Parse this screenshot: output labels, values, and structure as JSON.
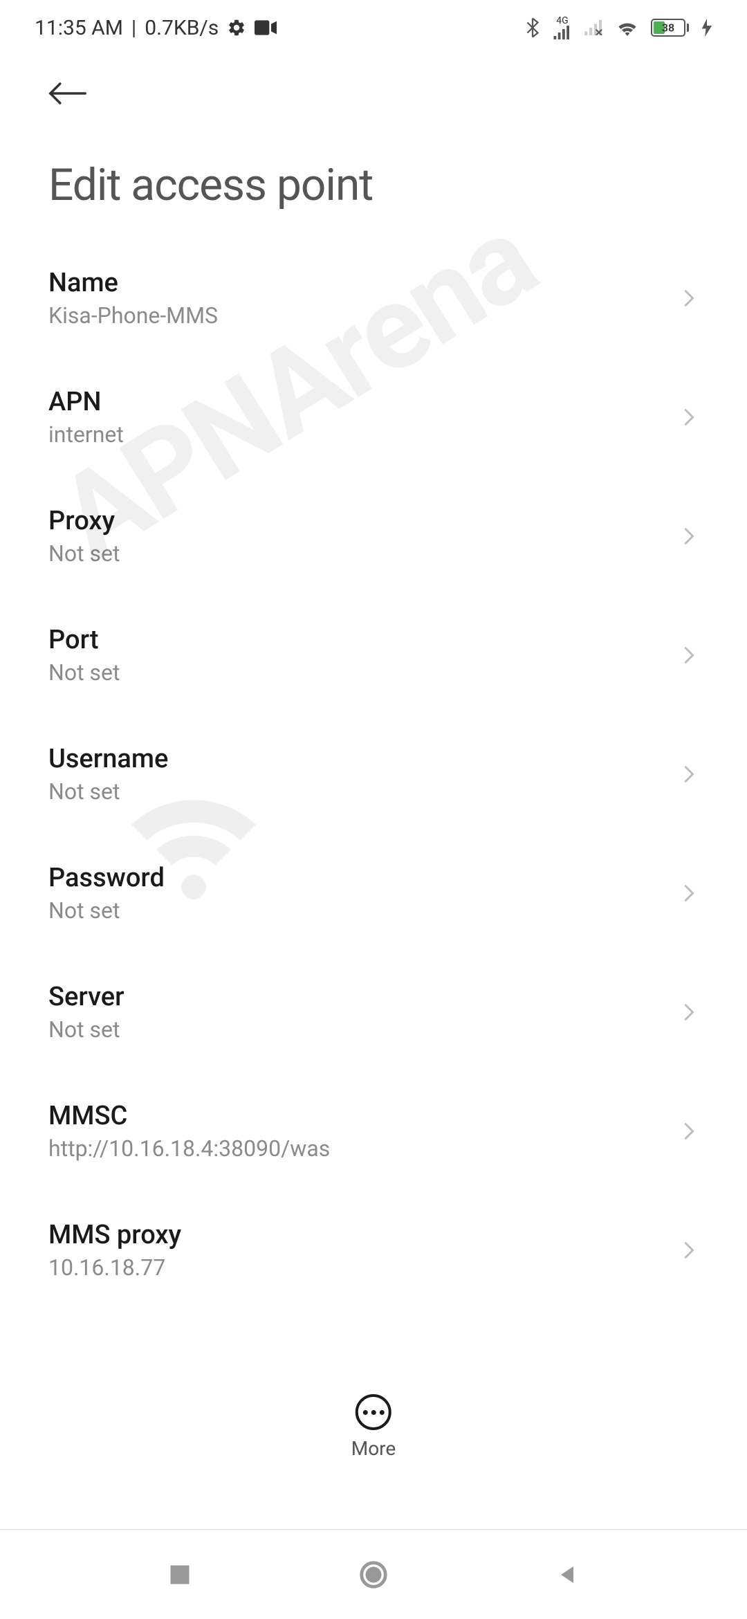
{
  "status_bar": {
    "time": "11:35 AM",
    "separator": "|",
    "speed": "0.7KB/s",
    "battery": "38",
    "network_label": "4G"
  },
  "header": {
    "title": "Edit access point"
  },
  "settings": [
    {
      "label": "Name",
      "value": "Kisa-Phone-MMS"
    },
    {
      "label": "APN",
      "value": "internet"
    },
    {
      "label": "Proxy",
      "value": "Not set"
    },
    {
      "label": "Port",
      "value": "Not set"
    },
    {
      "label": "Username",
      "value": "Not set"
    },
    {
      "label": "Password",
      "value": "Not set"
    },
    {
      "label": "Server",
      "value": "Not set"
    },
    {
      "label": "MMSC",
      "value": "http://10.16.18.4:38090/was"
    },
    {
      "label": "MMS proxy",
      "value": "10.16.18.77"
    }
  ],
  "more_button": {
    "label": "More"
  },
  "watermark_text": "APNArena"
}
